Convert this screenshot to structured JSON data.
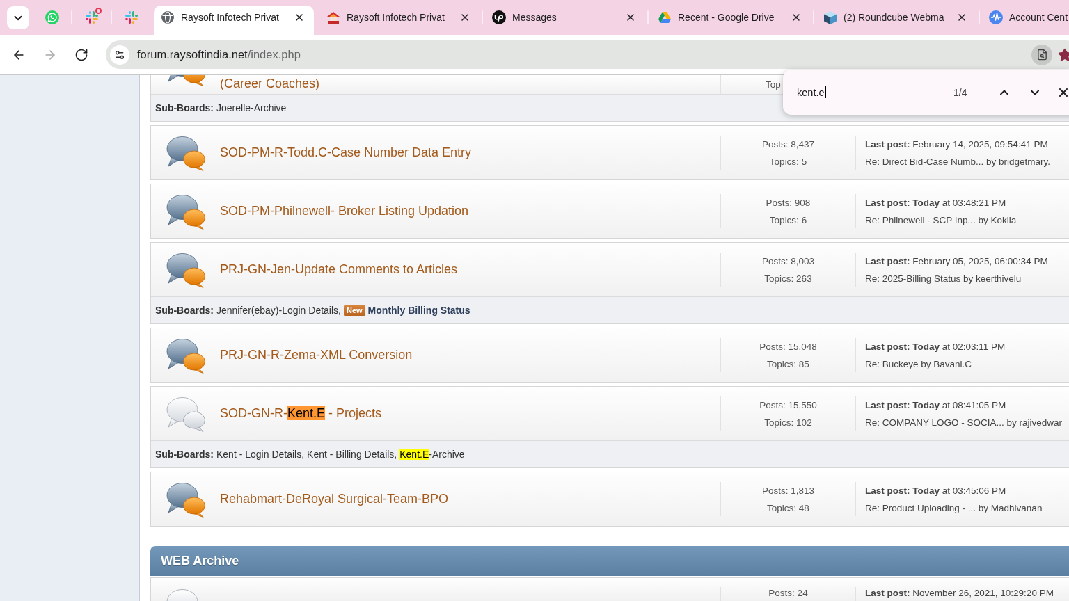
{
  "tab_strip": {
    "tabs": [
      {
        "kind": "pinned",
        "selected": false,
        "alert": false
      },
      {
        "kind": "pinned",
        "selected": false,
        "alert": true
      },
      {
        "kind": "pinned",
        "selected": false,
        "alert": false
      },
      {
        "kind": "tab",
        "title": "Raysoft Infotech Privat",
        "selected": true
      },
      {
        "kind": "tab",
        "title": "Raysoft Infotech Privat",
        "selected": false
      },
      {
        "kind": "tab",
        "title": "Messages",
        "selected": false
      },
      {
        "kind": "tab",
        "title": "Recent - Google Drive",
        "selected": false
      },
      {
        "kind": "tab",
        "title": "(2) Roundcube Webma",
        "selected": false
      },
      {
        "kind": "tab",
        "title": "Account Cent",
        "selected": false
      }
    ]
  },
  "toolbar": {
    "nav_buttons": [
      {
        "kind": "back",
        "disabled": false
      },
      {
        "kind": "forward",
        "disabled": true
      },
      {
        "kind": "reload",
        "disabled": false
      }
    ],
    "address": {
      "host": "forum.raysoftindia.net",
      "path": "/index.php"
    },
    "bookmarked": true
  },
  "find_bar": {
    "query": "kent.e",
    "count": "1/4"
  },
  "forum": {
    "boards": [
      {
        "kind": "cut_top",
        "title": [
          {
            "text": "(Career Coaches)",
            "highlighted": false
          }
        ],
        "new_posts": true,
        "topics": "Top",
        "sub_boards": {
          "label": "Sub-Boards:",
          "items": [
            {
              "parts": [
                {
                  "text": "Joerelle-Archive",
                  "highlighted": false
                }
              ],
              "new": false
            }
          ]
        }
      },
      {
        "kind": "full",
        "title": [
          {
            "text": "SOD-PM-R-Todd.C-Case Number Data Entry",
            "highlighted": false
          }
        ],
        "new_posts": true,
        "posts": "Posts: 8,437",
        "topics": "Topics: 5",
        "last_post": "**Last post:** February 14, 2025, 09:54:41 PM",
        "last_topic": "Re: Direct Bid-Case Numb... by bridgetmary."
      },
      {
        "kind": "full",
        "title": [
          {
            "text": "SOD-PM-Philnewell- Broker Listing Updation",
            "highlighted": false
          }
        ],
        "new_posts": true,
        "posts": "Posts: 908",
        "topics": "Topics: 6",
        "last_post": "**Last post: Today** at 03:48:21 PM",
        "last_topic": "Re: Philnewell - SCP Inp... by Kokila"
      },
      {
        "kind": "full",
        "title": [
          {
            "text": "PRJ-GN-Jen-Update Comments to Articles",
            "highlighted": false
          }
        ],
        "new_posts": true,
        "posts": "Posts: 8,003",
        "topics": "Topics: 263",
        "last_post": "**Last post:** February 05, 2025, 06:00:34 PM",
        "last_topic": "Re: 2025-Billing Status by keerthivelu",
        "sub_boards": {
          "label": "Sub-Boards:",
          "items": [
            {
              "parts": [
                {
                  "text": "Jennifer(ebay)-Login Details,",
                  "highlighted": false
                }
              ],
              "new": false
            },
            {
              "parts": [
                {
                  "text": "Monthly Billing Status",
                  "highlighted": false
                }
              ],
              "new": true,
              "badge": "New"
            }
          ]
        }
      },
      {
        "kind": "full",
        "title": [
          {
            "text": "PRJ-GN-R-Zema-XML Conversion",
            "highlighted": false
          }
        ],
        "new_posts": true,
        "posts": "Posts: 15,048",
        "topics": "Topics: 85",
        "last_post": "**Last post: Today** at 02:03:11 PM",
        "last_topic": "Re: Buckeye by Bavani.C"
      },
      {
        "kind": "full",
        "title": [
          {
            "text": "SOD-GN-R-",
            "highlighted": false
          },
          {
            "text": "Kent.E",
            "highlighted": true,
            "current": true
          },
          {
            "text": " - Projects",
            "highlighted": false
          }
        ],
        "new_posts": false,
        "posts": "Posts: 15,550",
        "topics": "Topics: 102",
        "last_post": "**Last post: Today** at 08:41:05 PM",
        "last_topic": "Re: COMPANY LOGO - SOCIA... by rajivedwar",
        "sub_boards": {
          "label": "Sub-Boards:",
          "items": [
            {
              "parts": [
                {
                  "text": "Kent - Login Details,",
                  "highlighted": false
                }
              ],
              "new": false
            },
            {
              "parts": [
                {
                  "text": "Kent - Billing Details,",
                  "highlighted": false
                }
              ],
              "new": false
            },
            {
              "parts": [
                {
                  "text": "Kent.E",
                  "highlighted": true,
                  "current": false
                },
                {
                  "text": "-Archive",
                  "highlighted": false
                }
              ],
              "new": false
            }
          ]
        }
      },
      {
        "kind": "full",
        "title": [
          {
            "text": "Rehabmart-DeRoyal Surgical-Team-BPO",
            "highlighted": false
          }
        ],
        "new_posts": true,
        "posts": "Posts: 1,813",
        "topics": "Topics: 48",
        "last_post": "**Last post: Today** at 03:45:06 PM",
        "last_topic": "Re: Product Uploading - ... by Madhivanan"
      }
    ],
    "category": {
      "title": "WEB Archive",
      "boards": [
        {
          "kind": "cut_bottom",
          "new_posts": false,
          "posts": "Posts: 24",
          "last_post": "**Last post:** November 26, 2021, 10:29:20 PM"
        }
      ]
    }
  }
}
